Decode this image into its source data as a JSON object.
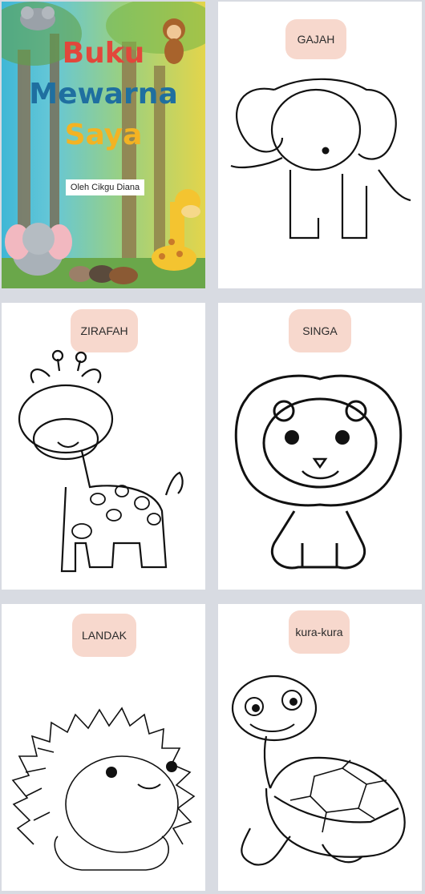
{
  "cover": {
    "title_line1": "Buku",
    "title_line2": "Mewarna",
    "title_line3": "Saya",
    "author": "Oleh Cikgu Diana"
  },
  "pages": [
    {
      "label": "GAJAH",
      "animal": "elephant"
    },
    {
      "label": "ZIRAFAH",
      "animal": "giraffe"
    },
    {
      "label": "SINGA",
      "animal": "lion"
    },
    {
      "label": "LANDAK",
      "animal": "hedgehog"
    },
    {
      "label": "kura-kura",
      "animal": "turtle"
    }
  ],
  "colors": {
    "background": "#d8dbe2",
    "label_bg": "#f7d8cd",
    "title_red": "#e2473b",
    "title_blue": "#1f6fa0",
    "title_yellow": "#f3b323"
  }
}
